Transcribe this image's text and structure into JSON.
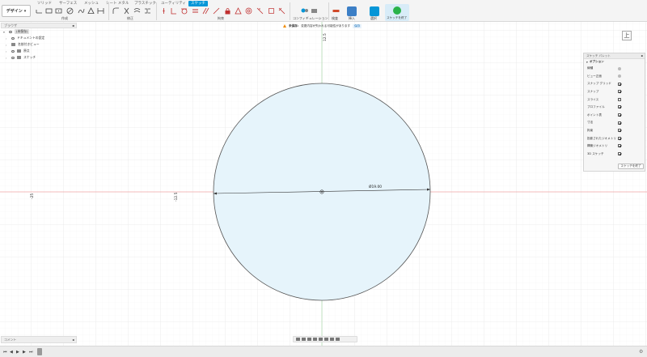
{
  "workspace": "デザイン",
  "tabs": [
    "ソリッド",
    "サーフェス",
    "メッシュ",
    "シート メタル",
    "プラスチック",
    "ユーティリティ",
    "スケッチ"
  ],
  "groups": {
    "create": "作成",
    "modify": "修正",
    "constraints": "拘束",
    "configure": "コンフィギュレーション",
    "inspect": "検査",
    "insert": "挿入",
    "select": "選択",
    "finish": "スケッチを終了"
  },
  "browser": {
    "title": "ブラウザ",
    "items": [
      {
        "label": "(未保存)"
      },
      {
        "label": "ドキュメントの設定"
      },
      {
        "label": "名前付きビュー"
      },
      {
        "label": "原点"
      },
      {
        "label": "スケッチ"
      }
    ]
  },
  "warning": {
    "label": "未保存:",
    "message": "変更内容が失われる可能性があります",
    "link": "保存"
  },
  "viewcube": {
    "face": "上"
  },
  "palette": {
    "title": "スケッチ パレット",
    "section": "オプション",
    "options": [
      {
        "label": "線種",
        "checked": false,
        "kind": "icon"
      },
      {
        "label": "ビュー正面",
        "checked": false,
        "kind": "icon"
      },
      {
        "label": "スナップ グリッド",
        "checked": true,
        "kind": "check"
      },
      {
        "label": "スナップ",
        "checked": true,
        "kind": "check"
      },
      {
        "label": "スライス",
        "checked": false,
        "kind": "check"
      },
      {
        "label": "プロファイル",
        "checked": true,
        "kind": "check"
      },
      {
        "label": "ポイント表",
        "checked": true,
        "kind": "check"
      },
      {
        "label": "寸法",
        "checked": true,
        "kind": "check"
      },
      {
        "label": "拘束",
        "checked": true,
        "kind": "check"
      },
      {
        "label": "投影されたジオメトリ",
        "checked": true,
        "kind": "check"
      },
      {
        "label": "構築ジオメトリ",
        "checked": true,
        "kind": "check"
      },
      {
        "label": "3D スケッチ",
        "checked": true,
        "kind": "check"
      }
    ],
    "finish_button": "スケッチを終了"
  },
  "sketch": {
    "diameter_label": "Ø19.00",
    "top_value": "12.5",
    "left_value_1": "-25",
    "left_value_2": "-12.5"
  },
  "comments": {
    "title": "コメント"
  },
  "colors": {
    "accent": "#0696d7",
    "circle_fill": "#e6f4fb",
    "axis_red": "#f0a8a8",
    "axis_green": "#a8d8a8"
  }
}
